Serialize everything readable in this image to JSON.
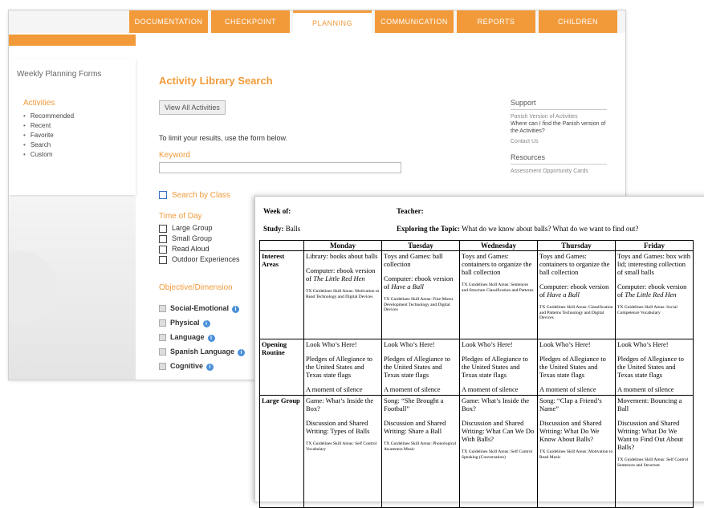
{
  "app": {
    "tabs": [
      {
        "label": "DOCUMENTATION"
      },
      {
        "label": "CHECKPOINT"
      },
      {
        "label": "PLANNING",
        "active": true
      },
      {
        "label": "COMMUNICATION"
      },
      {
        "label": "REPORTS"
      },
      {
        "label": "CHILDREN"
      }
    ],
    "sidebar": {
      "title": "Weekly Planning Forms",
      "section": "Activities",
      "items": [
        "Recommended",
        "Recent",
        "Favorite",
        "Search",
        "Custom"
      ]
    },
    "main": {
      "title": "Activity Library Search",
      "view_all_button": "View All Activities",
      "narrow_text": "To limit your results, use the form below.",
      "keyword_label": "Keyword",
      "keyword_value": "",
      "search_by_class": "Search by Class",
      "time_of_day_label": "Time of Day",
      "time_of_day": [
        "Large Group",
        "Small Group",
        "Read Aloud",
        "Outdoor Experiences"
      ],
      "objectives_label": "Objective/Dimension",
      "objectives": [
        "Social-Emotional",
        "Physical",
        "Language",
        "Spanish Language",
        "Cognitive"
      ]
    },
    "right": {
      "support_head": "Support",
      "support_links": [
        "Panish Version of Activities",
        "Where can I find the Panish version of the Activities?",
        "Contact Us"
      ],
      "resources_head": "Resources",
      "resources_links": [
        "Assessment Opportunity Cards"
      ]
    },
    "accent": "#f29a3a"
  },
  "doc": {
    "week_of_label": "Week of:",
    "teacher_label": "Teacher:",
    "study_label": "Study:",
    "study_value": "Balls",
    "topic_label": "Exploring the Topic:",
    "topic_value": "What do we know about balls? What do we want to find out?",
    "days": [
      "Monday",
      "Tuesday",
      "Wednesday",
      "Thursday",
      "Friday"
    ],
    "rows": [
      {
        "label": "Interest Areas",
        "cells": [
          {
            "p1": "Library: books about balls",
            "p2": "Computer: ebook version of",
            "p2i": "The Little Red Hen",
            "sm": "TX Guidelines Skill Areas: Motivation to Read Technology and Digital Devices"
          },
          {
            "p1": "Toys and Games: ball collection",
            "p2": "Computer: ebook version of",
            "p2i": "Have a Ball",
            "sm": "TX Guidelines Skill Areas: Fine-Motor Development Technology and Digital Devices"
          },
          {
            "p1": "Toys and Games: containers to organize the ball collection",
            "p2": "",
            "p2i": "",
            "sm": "TX Guidelines Skill Areas: Sentences and Structure Classification and Patterns"
          },
          {
            "p1": "Toys and Games: containers to organize the ball collection",
            "p2": "Computer: ebook version of",
            "p2i": "Have a Ball",
            "sm": "TX Guidelines Skill Areas: Classification and Patterns Technology and Digital Devices"
          },
          {
            "p1": "Toys and Games: box with lid; interesting collection of small balls",
            "p2": "Computer: ebook version of",
            "p2i": "The Little Red Hen",
            "sm": "TX Guidelines Skill Areas: Social Competence Vocabulary"
          }
        ]
      },
      {
        "label": "Opening Routine",
        "cells": [
          {
            "p1": "Look Who’s Here!",
            "p2": "Pledges of Allegiance to the United States and Texas state flags",
            "p3": "A moment of silence"
          },
          {
            "p1": "Look Who’s Here!",
            "p2": "Pledges of Allegiance to the United States and Texas state flags",
            "p3": "A moment of silence"
          },
          {
            "p1": "Look Who’s Here!",
            "p2": "Pledges of Allegiance to the United States and Texas state flags",
            "p3": "A moment of silence"
          },
          {
            "p1": "Look Who’s Here!",
            "p2": "Pledges of Allegiance to the United States and Texas state flags",
            "p3": "A moment of silence"
          },
          {
            "p1": "Look Who’s Here!",
            "p2": "Pledges of Allegiance to the United States and Texas state flags",
            "p3": "A moment of silence"
          }
        ]
      },
      {
        "label": "Large Group",
        "cells": [
          {
            "p1": "Game: What’s Inside the Box?",
            "p2": "Discussion and Shared Writing: Types of Balls",
            "sm": "TX Guidelines Skill Areas: Self Control Vocabulary"
          },
          {
            "p1": "Song: “She Brought a Football”",
            "p2": "Discussion and Shared Writing: Share a Ball",
            "sm": "TX Guidelines Skill Areas: Phonological Awareness Music"
          },
          {
            "p1": "Game: What’s Inside the Box?",
            "p2": "Discussion and Shared Writing: What Can We Do With Balls?",
            "sm": "TX Guidelines Skill Areas: Self Control Speaking (Conversation)"
          },
          {
            "p1": "Song: “Clap a Friend’s Name”",
            "p2": "Discussion and Shared Writing: What Do We Know About Balls?",
            "sm": "TX Guidelines Skill Areas: Motivation to Read Music"
          },
          {
            "p1": "Movement: Bouncing a Ball",
            "p2": "Discussion and Shared Writing: What Do We Want to Find Out About Balls?",
            "sm": "TX Guidelines Skill Areas: Self Control Sentences and Structure"
          }
        ]
      }
    ]
  }
}
